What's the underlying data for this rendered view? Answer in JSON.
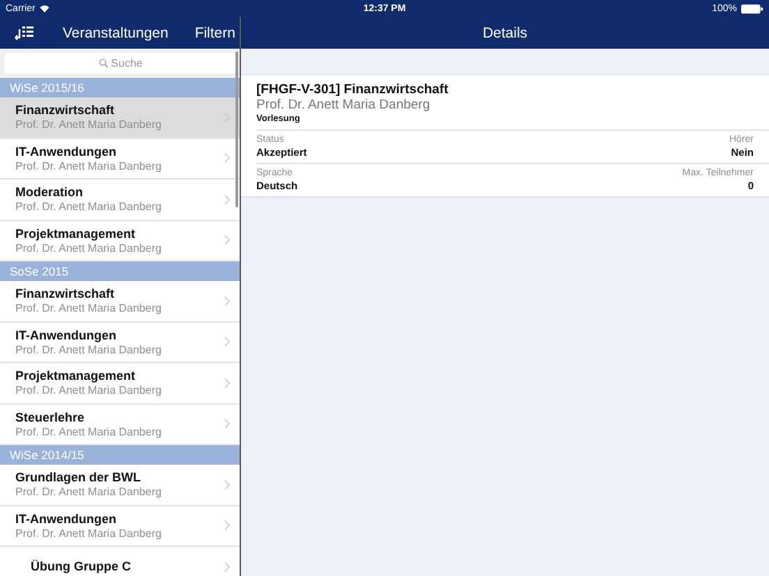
{
  "status_bar": {
    "carrier": "Carrier",
    "time": "12:37 PM",
    "battery": "100%"
  },
  "sidebar": {
    "title": "Veranstaltungen",
    "filter_button": "Filtern",
    "search": {
      "placeholder": "Suche"
    },
    "sections": [
      {
        "title": "WiSe 2015/16",
        "items": [
          {
            "title": "Finanzwirtschaft",
            "subtitle": "Prof. Dr. Anett Maria Danberg",
            "selected": true,
            "indented": false
          },
          {
            "title": "IT-Anwendungen",
            "subtitle": "Prof. Dr. Anett Maria Danberg",
            "selected": false,
            "indented": false
          },
          {
            "title": "Moderation",
            "subtitle": "Prof. Dr. Anett Maria Danberg",
            "selected": false,
            "indented": false
          },
          {
            "title": "Projektmanagement",
            "subtitle": "Prof. Dr. Anett Maria Danberg",
            "selected": false,
            "indented": false
          }
        ]
      },
      {
        "title": "SoSe 2015",
        "items": [
          {
            "title": "Finanzwirtschaft",
            "subtitle": "Prof. Dr. Anett Maria Danberg",
            "selected": false,
            "indented": false
          },
          {
            "title": "IT-Anwendungen",
            "subtitle": "Prof. Dr. Anett Maria Danberg",
            "selected": false,
            "indented": false
          },
          {
            "title": "Projektmanagement",
            "subtitle": "Prof. Dr. Anett Maria Danberg",
            "selected": false,
            "indented": false
          },
          {
            "title": "Steuerlehre",
            "subtitle": "Prof. Dr. Anett Maria Danberg",
            "selected": false,
            "indented": false
          }
        ]
      },
      {
        "title": "WiSe 2014/15",
        "items": [
          {
            "title": "Grundlagen der BWL",
            "subtitle": "Prof. Dr. Anett Maria Danberg",
            "selected": false,
            "indented": false
          },
          {
            "title": "IT-Anwendungen",
            "subtitle": "Prof. Dr. Anett Maria Danberg",
            "selected": false,
            "indented": false
          },
          {
            "title": "Übung Gruppe C",
            "selected": false,
            "indented": true
          }
        ]
      }
    ]
  },
  "detail": {
    "title": "Details",
    "heading": "[FHGF-V-301] Finanzwirtschaft",
    "lecturer": "Prof. Dr. Anett Maria Danberg",
    "type": "Vorlesung",
    "fields": [
      [
        {
          "label": "Status",
          "value": "Akzeptiert"
        },
        {
          "label": "Hörer",
          "value": "Nein"
        }
      ],
      [
        {
          "label": "Sprache",
          "value": "Deutsch"
        },
        {
          "label": "Max. Teilnehmer",
          "value": "0"
        }
      ]
    ]
  }
}
